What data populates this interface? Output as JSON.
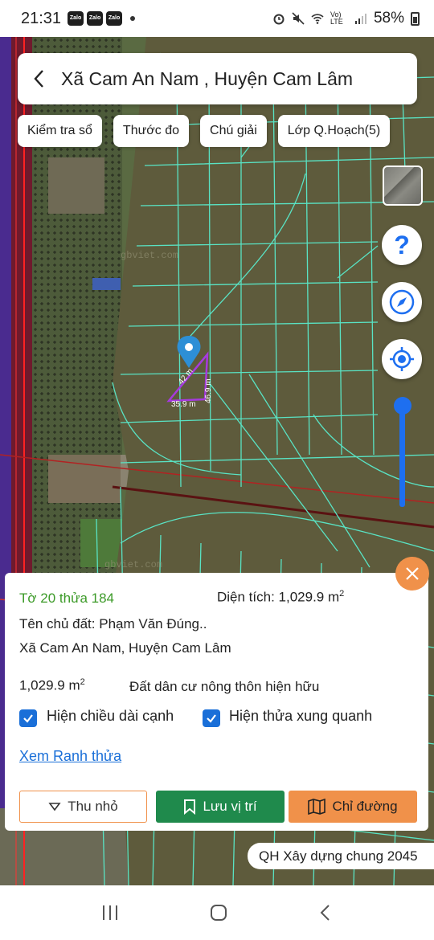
{
  "status": {
    "time": "21:31",
    "apps": [
      "Zalo",
      "Zalo",
      "Zalo"
    ],
    "network": "Vo) LTE",
    "battery": "58%"
  },
  "header": {
    "title": "Xã Cam An Nam , Huyện Cam Lâm"
  },
  "toolbar": {
    "check": "Kiểm tra sổ",
    "measure": "Thước đo",
    "legend": "Chú giải",
    "layers": "Lớp Q.Hoạch(5)"
  },
  "map": {
    "watermark": "gbviet.com",
    "edge_top": "42 m",
    "edge_right": "46.9 m",
    "edge_bottom": "35.9 m"
  },
  "side_buttons": {
    "help": "?"
  },
  "parcel": {
    "id": "Tờ 20 thửa 184",
    "area_label": "Diện tích: 1,029.9 m",
    "area_sup": "2",
    "owner": "Tên chủ đất: Phạm Văn Đúng..",
    "address": "Xã Cam An Nam, Huyện Cam Lâm",
    "area_value": "1,029.9 m",
    "area_value_sup": "2",
    "land_type": "Đất dân cư nông thôn hiện hữu",
    "show_edges": "Hiện chiều dài cạnh",
    "show_neighbors": "Hiện thửa xung quanh",
    "view_boundary": "Xem Ranh thửa"
  },
  "actions": {
    "minimize": "Thu nhỏ",
    "save": "Lưu vị trí",
    "directions": "Chỉ đường"
  },
  "plan_badge": "QH Xây dựng chung 2045",
  "colors": {
    "map_bg": "#5e5b3c",
    "parcel_lines": "#59e3c4",
    "accent_orange": "#f0914a",
    "accent_green": "#1f8a4c",
    "accent_blue": "#1a6fd8"
  }
}
